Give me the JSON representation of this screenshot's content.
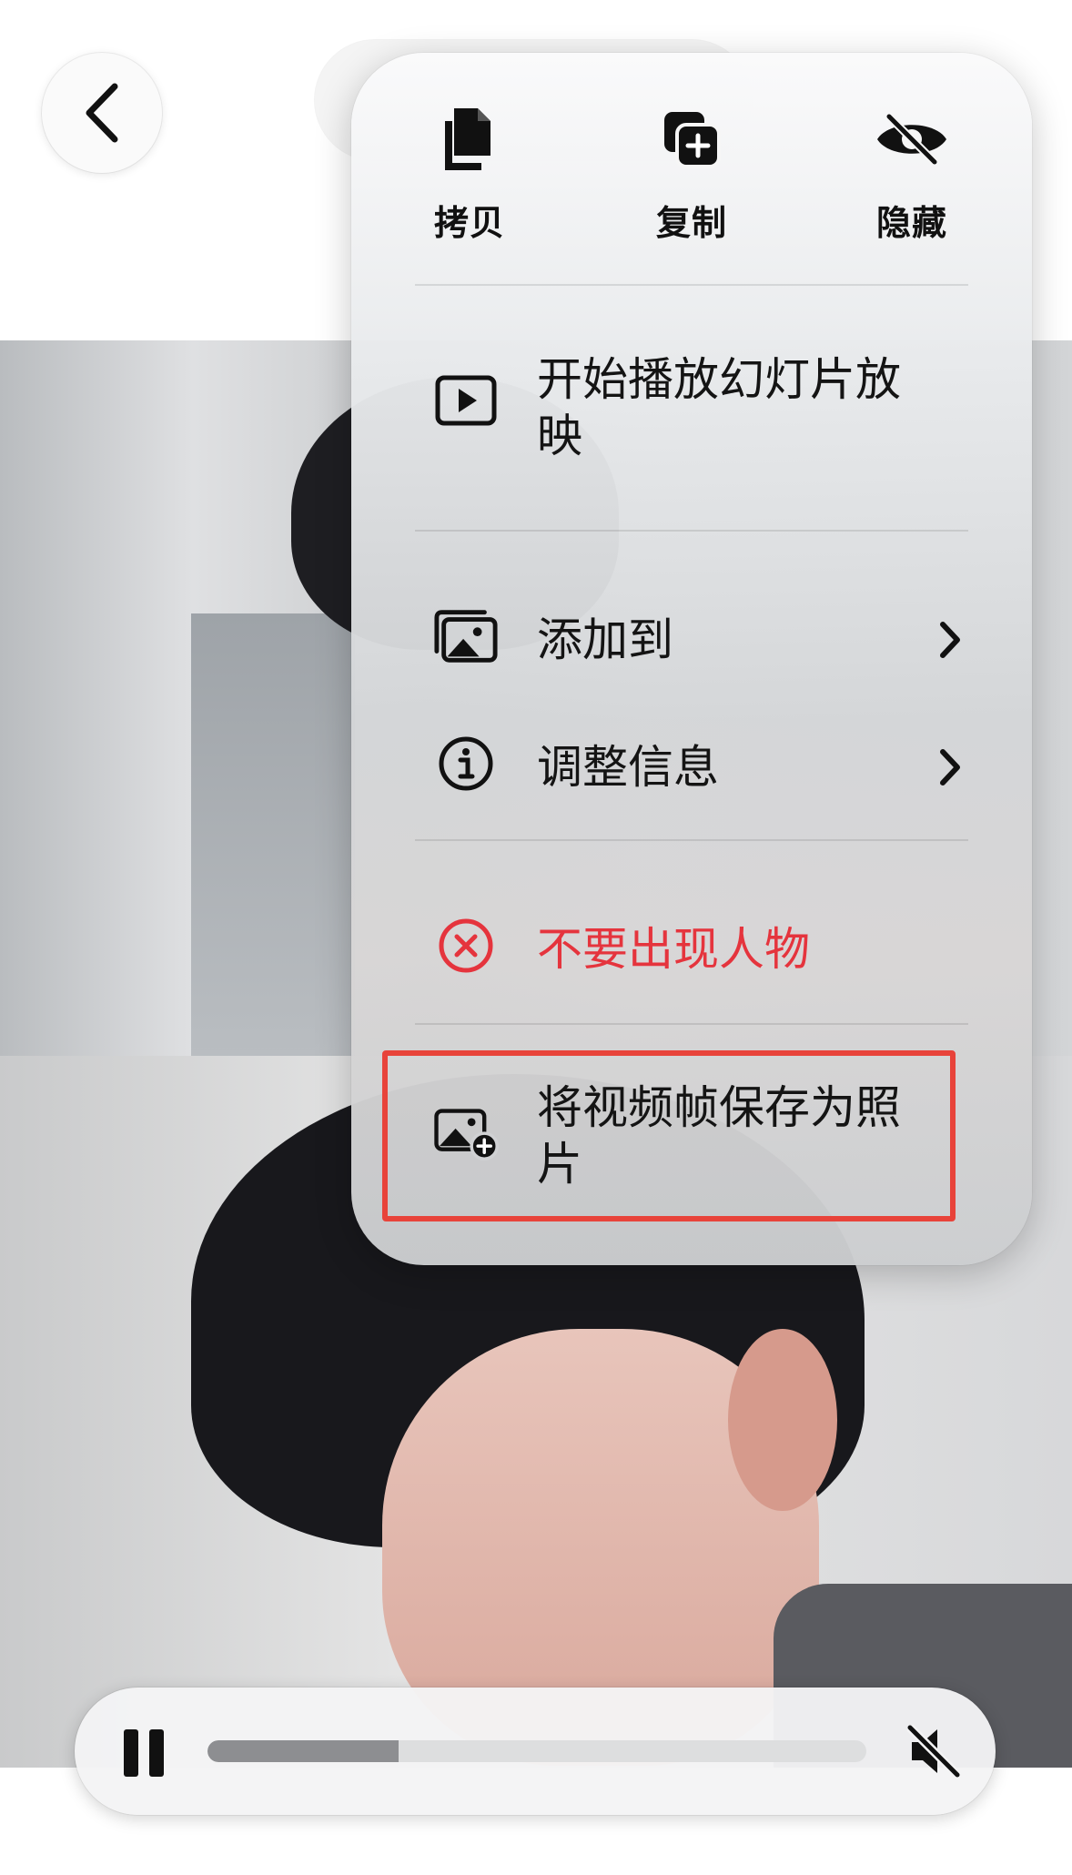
{
  "quick_actions": [
    {
      "label": "拷贝",
      "icon": "copy-icon"
    },
    {
      "label": "复制",
      "icon": "duplicate-icon"
    },
    {
      "label": "隐藏",
      "icon": "eye-slash-icon"
    }
  ],
  "menu": {
    "slideshow": {
      "label": "开始播放幻灯片放映",
      "icon": "play-rectangle-icon"
    },
    "add_to": {
      "label": "添加到",
      "icon": "photo-stack-icon"
    },
    "adjust_info": {
      "label": "调整信息",
      "icon": "info-icon"
    },
    "hide_person": {
      "label": "不要出现人物",
      "icon": "x-circle-icon"
    },
    "save_frame": {
      "label": "将视频帧保存为照片",
      "icon": "photo-badge-plus-icon"
    }
  },
  "video": {
    "progress": 0.29
  },
  "colors": {
    "danger": "#e5343d",
    "highlight": "#e8433a"
  }
}
